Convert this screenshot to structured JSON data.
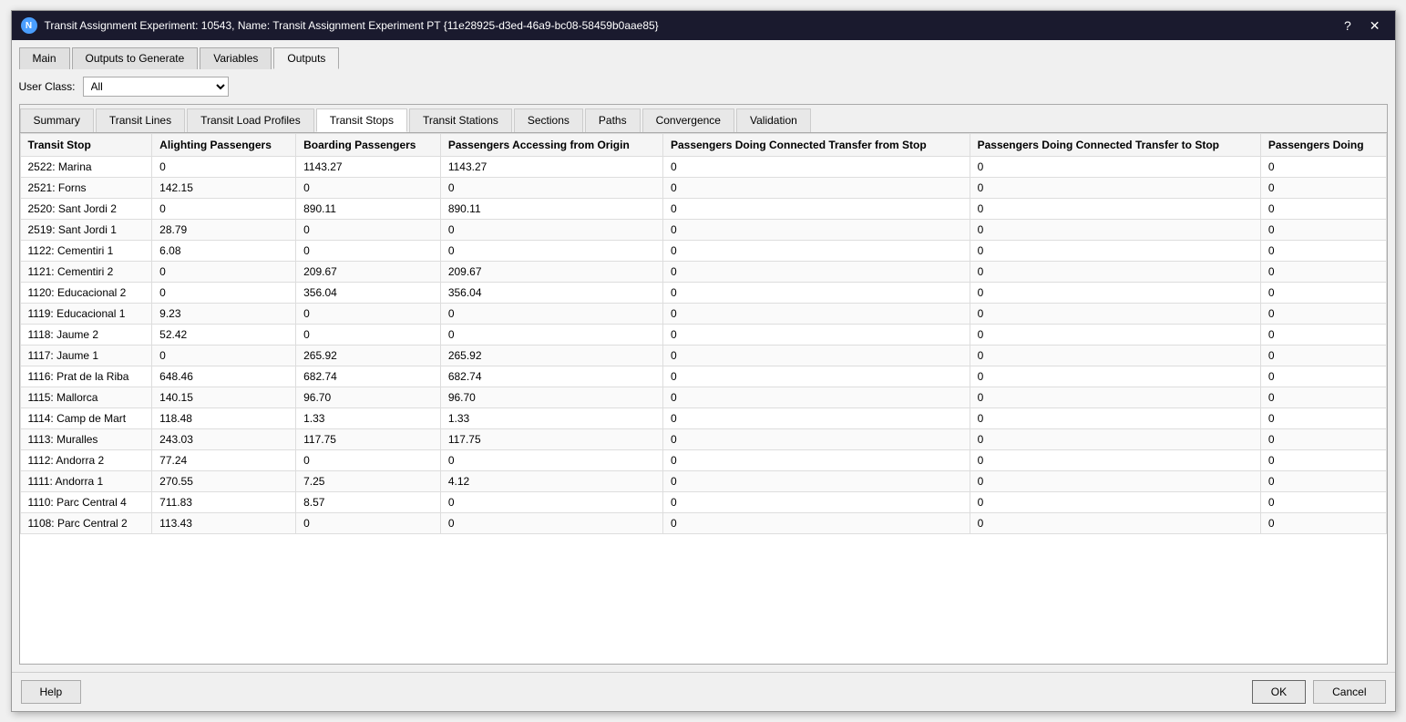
{
  "window": {
    "title": "Transit Assignment Experiment: 10543, Name: Transit Assignment Experiment PT  {11e28925-d3ed-46a9-bc08-58459b0aae85}",
    "icon_label": "N"
  },
  "top_tabs": [
    {
      "label": "Main",
      "active": false
    },
    {
      "label": "Outputs to Generate",
      "active": false
    },
    {
      "label": "Variables",
      "active": false
    },
    {
      "label": "Outputs",
      "active": true
    }
  ],
  "user_class": {
    "label": "User Class:",
    "value": "All",
    "options": [
      "All"
    ]
  },
  "sub_tabs": [
    {
      "label": "Summary",
      "active": false
    },
    {
      "label": "Transit Lines",
      "active": false
    },
    {
      "label": "Transit Load Profiles",
      "active": false
    },
    {
      "label": "Transit Stops",
      "active": true
    },
    {
      "label": "Transit Stations",
      "active": false
    },
    {
      "label": "Sections",
      "active": false
    },
    {
      "label": "Paths",
      "active": false
    },
    {
      "label": "Convergence",
      "active": false
    },
    {
      "label": "Validation",
      "active": false
    }
  ],
  "table": {
    "columns": [
      "Transit Stop",
      "Alighting Passengers",
      "Boarding Passengers",
      "Passengers Accessing from Origin",
      "Passengers Doing Connected Transfer from Stop",
      "Passengers Doing Connected Transfer to Stop",
      "Passengers Doing"
    ],
    "rows": [
      [
        "2522: Marina",
        "0",
        "1143.27",
        "1143.27",
        "0",
        "0",
        "0"
      ],
      [
        "2521: Forns",
        "142.15",
        "0",
        "0",
        "0",
        "0",
        "0"
      ],
      [
        "2520: Sant Jordi 2",
        "0",
        "890.11",
        "890.11",
        "0",
        "0",
        "0"
      ],
      [
        "2519: Sant Jordi 1",
        "28.79",
        "0",
        "0",
        "0",
        "0",
        "0"
      ],
      [
        "1122: Cementiri 1",
        "6.08",
        "0",
        "0",
        "0",
        "0",
        "0"
      ],
      [
        "1121: Cementiri 2",
        "0",
        "209.67",
        "209.67",
        "0",
        "0",
        "0"
      ],
      [
        "1120: Educacional 2",
        "0",
        "356.04",
        "356.04",
        "0",
        "0",
        "0"
      ],
      [
        "1119: Educacional 1",
        "9.23",
        "0",
        "0",
        "0",
        "0",
        "0"
      ],
      [
        "1118: Jaume 2",
        "52.42",
        "0",
        "0",
        "0",
        "0",
        "0"
      ],
      [
        "1117: Jaume 1",
        "0",
        "265.92",
        "265.92",
        "0",
        "0",
        "0"
      ],
      [
        "1116: Prat de la Riba",
        "648.46",
        "682.74",
        "682.74",
        "0",
        "0",
        "0"
      ],
      [
        "1115: Mallorca",
        "140.15",
        "96.70",
        "96.70",
        "0",
        "0",
        "0"
      ],
      [
        "1114: Camp de Mart",
        "118.48",
        "1.33",
        "1.33",
        "0",
        "0",
        "0"
      ],
      [
        "1113: Muralles",
        "243.03",
        "117.75",
        "117.75",
        "0",
        "0",
        "0"
      ],
      [
        "1112: Andorra 2",
        "77.24",
        "0",
        "0",
        "0",
        "0",
        "0"
      ],
      [
        "1111: Andorra 1",
        "270.55",
        "7.25",
        "4.12",
        "0",
        "0",
        "0"
      ],
      [
        "1110: Parc Central 4",
        "711.83",
        "8.57",
        "0",
        "0",
        "0",
        "0"
      ],
      [
        "1108: Parc Central 2",
        "113.43",
        "0",
        "0",
        "0",
        "0",
        "0"
      ]
    ]
  },
  "buttons": {
    "help": "Help",
    "ok": "OK",
    "cancel": "Cancel"
  },
  "title_bar_buttons": {
    "help": "?",
    "close": "✕"
  }
}
